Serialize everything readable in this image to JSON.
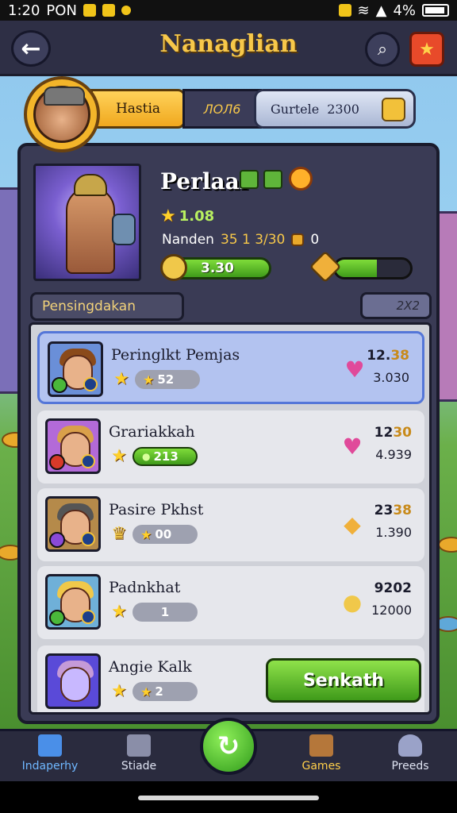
{
  "status_bar": {
    "time": "1:20",
    "carrier": "PON",
    "battery": "4%"
  },
  "header": {
    "title": "Nanaglian"
  },
  "profile": {
    "name": "Hastia",
    "id": "ЛОЛ6",
    "currency_label": "Gurtele",
    "currency_value": "2300"
  },
  "hero": {
    "name": "Perlaal",
    "rating": "1.08",
    "stats_label": "Nanden",
    "stats_value": "35 1 3/30",
    "stats_count": "0",
    "bar_value": "3.30",
    "progress": 0.55
  },
  "section": {
    "label": "Pensingdakan",
    "count": "2Х2"
  },
  "list": [
    {
      "name": "Peringlkt Pemjas",
      "chip": "52",
      "v1": "12.",
      "v1_acc": "38",
      "v2": "3.030",
      "icon": "heart-icon",
      "chip_style": "grey"
    },
    {
      "name": "Grariakkah",
      "chip": "213",
      "v1": "12",
      "v1_acc": "30",
      "v2": "4.939",
      "icon": "heart-icon",
      "chip_style": "green"
    },
    {
      "name": "Pasire Pkhst",
      "chip": "00",
      "v1": "23",
      "v1_acc": "38",
      "v2": "1.390",
      "icon": "gold-mask-icon",
      "chip_style": "grey"
    },
    {
      "name": "Padnkhat",
      "chip": "1",
      "v1": "9202",
      "v1_acc": "",
      "v2": "12000",
      "icon": "coin-icon",
      "chip_style": "grey"
    },
    {
      "name": "Angie Kalk",
      "chip": "2",
      "v1": "",
      "v1_acc": "",
      "v2": "",
      "icon": "",
      "chip_style": "grey"
    }
  ],
  "action_button": "Senkath",
  "nav": {
    "home": "Indaperhy",
    "stats": "Stiade",
    "games": "Games",
    "profile": "Preeds"
  },
  "colors": {
    "accent": "#f7c84a",
    "panel": "#3a3b55",
    "selected": "#b3c3f0",
    "green": "#5fb53a"
  }
}
